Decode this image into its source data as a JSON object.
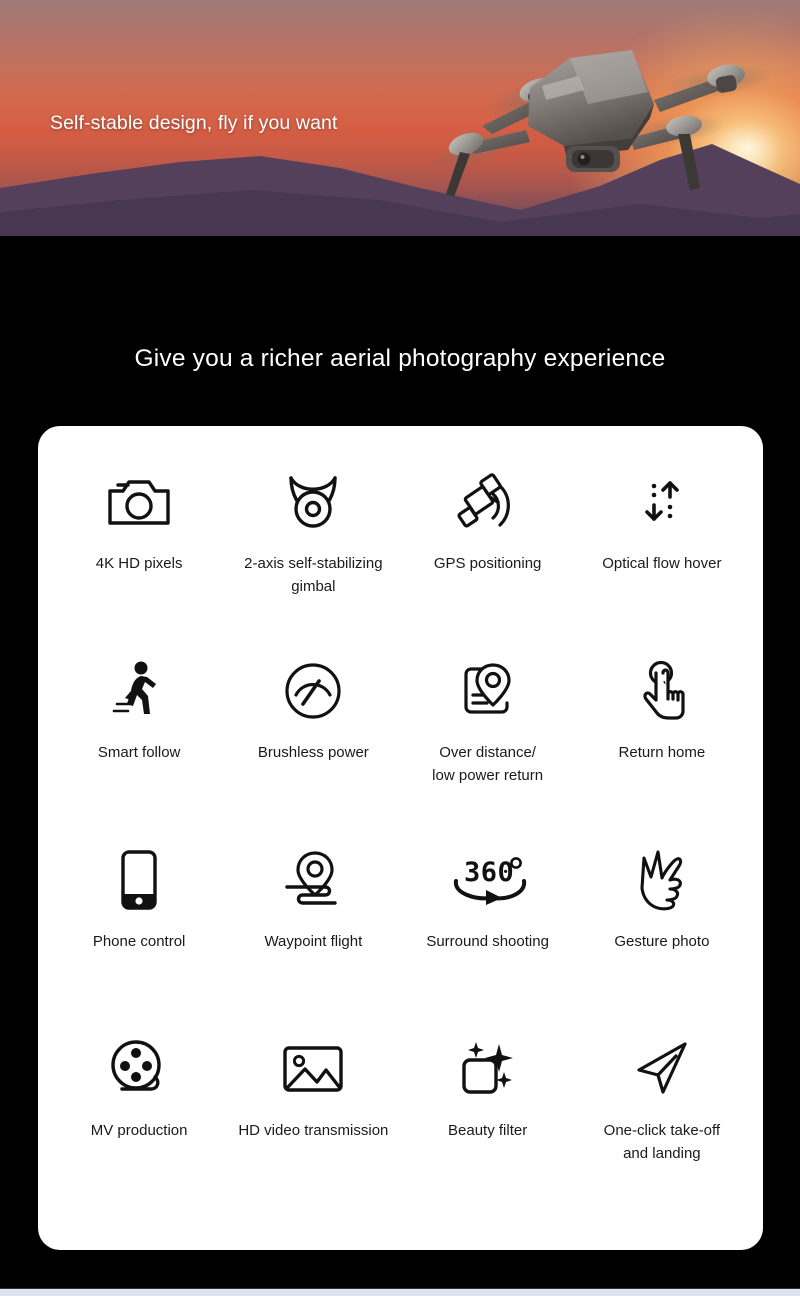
{
  "hero": {
    "title": "Self-stable design, fly if you want",
    "scene_icon": "drone-sunset-photo",
    "colors": {
      "sky_top": "#9c7b78",
      "sky_mid": "#d4684c",
      "mountain": "#5a4358",
      "sun": "#fff6d2"
    }
  },
  "section": {
    "heading": "Give you a richer aerial photography experience",
    "background": "#000000",
    "card_background": "#ffffff"
  },
  "features": [
    {
      "label": "4K HD pixels",
      "icon": "camera-icon"
    },
    {
      "label": "2-axis self-stabilizing gimbal",
      "icon": "gimbal-icon"
    },
    {
      "label": "GPS positioning",
      "icon": "satellite-icon"
    },
    {
      "label": "Optical flow hover",
      "icon": "updown-arrows-icon"
    },
    {
      "label": "Smart follow",
      "icon": "walking-person-icon"
    },
    {
      "label": "Brushless power",
      "icon": "speedometer-icon"
    },
    {
      "label": "Over distance/\nlow power return",
      "icon": "map-pin-icon"
    },
    {
      "label": "Return home",
      "icon": "tap-hand-icon"
    },
    {
      "label": "Phone control",
      "icon": "smartphone-icon"
    },
    {
      "label": "Waypoint flight",
      "icon": "waypoint-path-icon"
    },
    {
      "label": "Surround shooting",
      "icon": "360-degrees-icon"
    },
    {
      "label": "Gesture photo",
      "icon": "hand-gesture-icon"
    },
    {
      "label": "MV production",
      "icon": "film-reel-icon"
    },
    {
      "label": "HD video transmission",
      "icon": "image-mountain-icon"
    },
    {
      "label": "Beauty filter",
      "icon": "sparkle-square-icon"
    },
    {
      "label": "One-click take-off\nand landing",
      "icon": "paper-plane-icon"
    }
  ]
}
